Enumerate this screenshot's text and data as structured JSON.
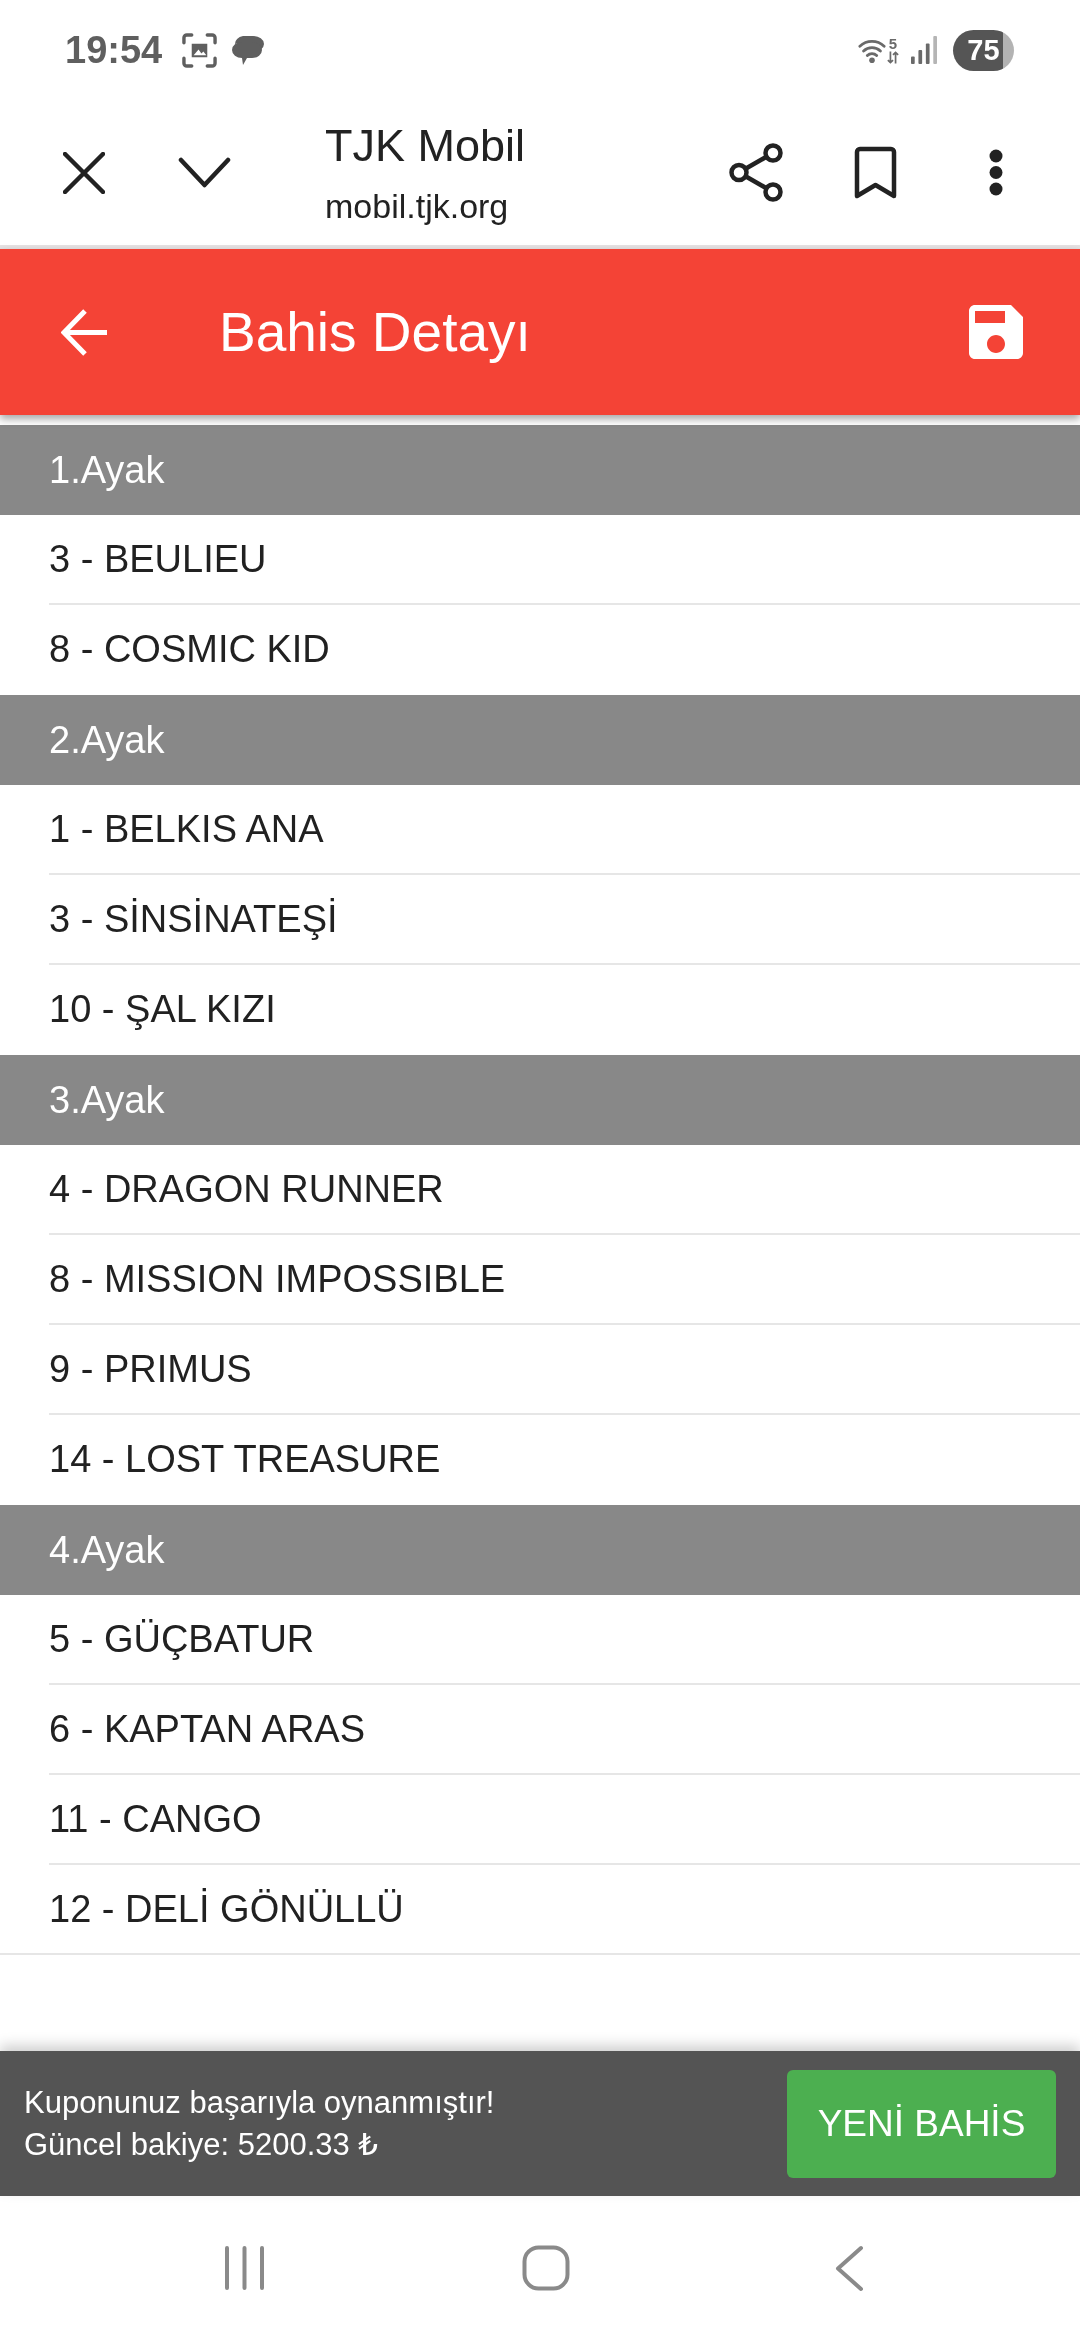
{
  "status_bar": {
    "time": "19:54",
    "network_type": "5",
    "battery": "75"
  },
  "browser_bar": {
    "title": "TJK Mobil",
    "url": "mobil.tjk.org"
  },
  "app_bar": {
    "title": "Bahis Detayı"
  },
  "legs": [
    {
      "title": "1.Ayak",
      "horses": [
        "3 - BEULIEU",
        "8 - COSMIC KID"
      ]
    },
    {
      "title": "2.Ayak",
      "horses": [
        "1 - BELKIS ANA",
        "3 - SİNSİNATEŞİ",
        "10 - ŞAL KIZI"
      ]
    },
    {
      "title": "3.Ayak",
      "horses": [
        "4 - DRAGON RUNNER",
        "8 - MISSION IMPOSSIBLE",
        "9 - PRIMUS",
        "14 - LOST TREASURE"
      ]
    },
    {
      "title": "4.Ayak",
      "horses": [
        "5 - GÜÇBATUR",
        "6 - KAPTAN ARAS",
        "11 - CANGO",
        "12 - DELİ GÖNÜLLÜ"
      ]
    }
  ],
  "snackbar": {
    "lines": [
      "Kuponunuz başarıyla oynanmıştır!",
      "Güncel bakiye: 5200.33 ₺"
    ],
    "action": "YENİ BAHİS"
  }
}
